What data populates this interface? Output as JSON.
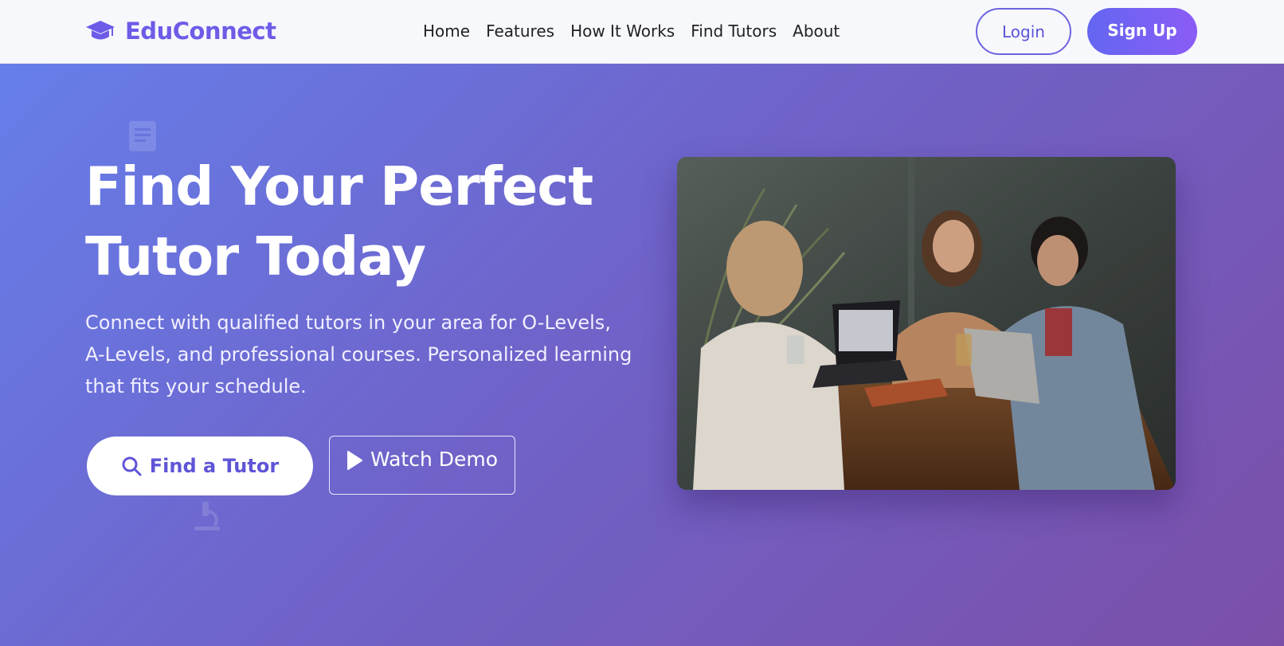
{
  "header": {
    "brand_name": "EduConnect",
    "brand_icon": "graduation-cap-icon",
    "nav": [
      "Home",
      "Features",
      "How It Works",
      "Find Tutors",
      "About"
    ],
    "login_label": "Login",
    "signup_label": "Sign Up"
  },
  "hero": {
    "title_line1": "Find Your Perfect",
    "title_line2": "Tutor Today",
    "subtitle": "Connect with qualified tutors in your area for O-Levels, A-Levels, and professional courses. Personalized learning that fits your schedule.",
    "find_tutor_label": "Find a Tutor",
    "find_tutor_icon": "search-icon",
    "watch_demo_label": "Watch Demo",
    "watch_demo_icon": "play-icon"
  },
  "colors": {
    "brand": "#6c5ce7",
    "gradient_start": "#667eea",
    "gradient_end": "#7b4fa8",
    "signup_start": "#6366f1",
    "signup_end": "#8b5cf6"
  }
}
